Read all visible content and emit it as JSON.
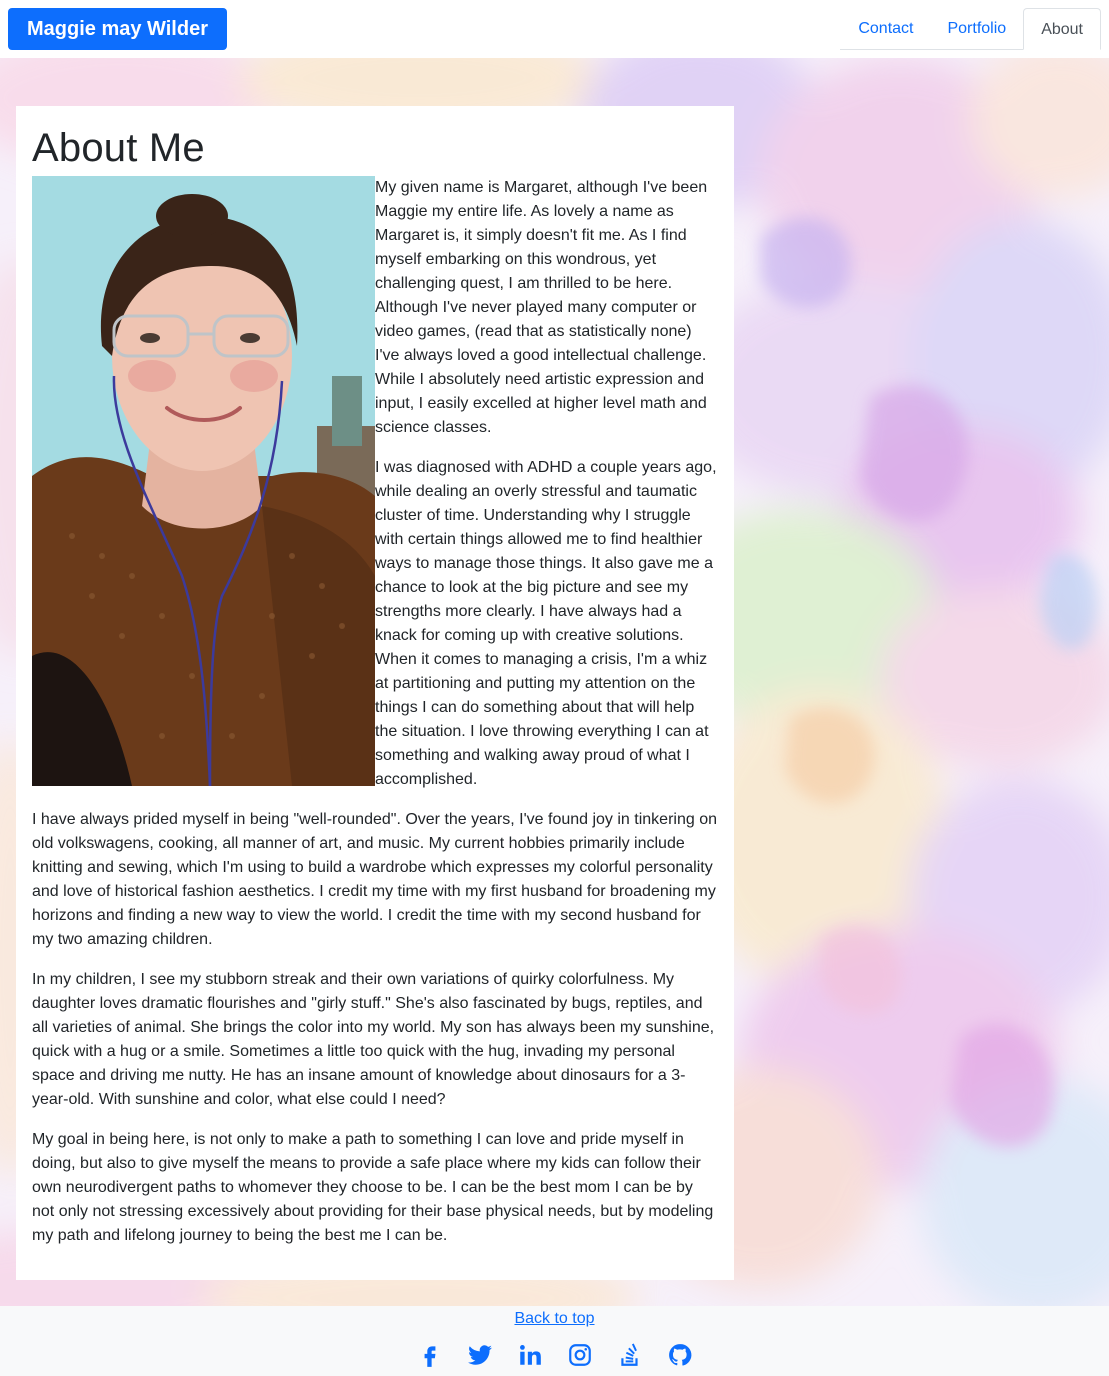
{
  "navbar": {
    "brand": "Maggie may Wilder",
    "tabs": [
      {
        "label": "Contact",
        "active": false
      },
      {
        "label": "Portfolio",
        "active": false
      },
      {
        "label": "About",
        "active": true
      }
    ]
  },
  "main": {
    "title": "About Me",
    "paragraphs": [
      "My given name is Margaret, although I've been Maggie my entire life. As lovely a name as Margaret is, it simply doesn't fit me. As I find myself embarking on this wondrous, yet challenging quest, I am thrilled to be here. Although I've never played many computer or video games, (read that as statistically none) I've always loved a good intellectual challenge. While I absolutely need artistic expression and input, I easily excelled at higher level math and science classes.",
      "I was diagnosed with ADHD a couple years ago, while dealing an overly stressful and taumatic cluster of time. Understanding why I struggle with certain things allowed me to find healthier ways to manage those things. It also gave me a chance to look at the big picture and see my strengths more clearly. I have always had a knack for coming up with creative solutions. When it comes to managing a crisis, I'm a whiz at partitioning and putting my attention on the things I can do something about that will help the situation. I love throwing everything I can at something and walking away proud of what I accomplished.",
      "I have always prided myself in being \"well-rounded\". Over the years, I've found joy in tinkering on old volkswagens, cooking, all manner of art, and music. My current hobbies primarily include knitting and sewing, which I'm using to build a wardrobe which expresses my colorful personality and love of historical fashion aesthetics. I credit my time with my first husband for broadening my horizons and finding a new way to view the world. I credit the time with my second husband for my two amazing children.",
      "In my children, I see my stubborn streak and their own variations of quirky colorfulness. My daughter loves dramatic flourishes and \"girly stuff.\" She's also fascinated by bugs, reptiles, and all varieties of animal. She brings the color into my world. My son has always been my sunshine, quick with a hug or a smile. Sometimes a little too quick with the hug, invading my personal space and driving me nutty. He has an insane amount of knowledge about dinosaurs for a 3-year-old. With sunshine and color, what else could I need?",
      "My goal in being here, is not only to make a path to something I can love and pride myself in doing, but also to give myself the means to provide a safe place where my kids can follow their own neurodivergent paths to whomever they choose to be. I can be the best mom I can be by not only not stressing excessively about providing for their base physical needs, but by modeling my path and lifelong journey to being the best me I can be."
    ]
  },
  "footer": {
    "back_to_top": "Back to top",
    "social_icons": [
      "facebook-icon",
      "twitter-icon",
      "linkedin-icon",
      "instagram-icon",
      "stack-overflow-icon",
      "github-icon"
    ]
  },
  "colors": {
    "accent": "#0d6efd",
    "text": "#212529",
    "footer_bg": "#f8f9fa"
  }
}
